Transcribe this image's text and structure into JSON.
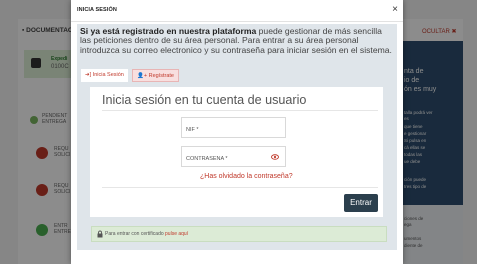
{
  "background": {
    "doc_title": "DOCUMENTACI",
    "hide_label": "OCULTAR",
    "hide_icon": "close-icon",
    "left_items": [
      {
        "line1": "Expedi",
        "line2": "0100C"
      },
      {
        "line1": "PENDIENT",
        "line2": "ENTREGA"
      },
      {
        "line1": "REQU",
        "line2": "SOLICI"
      },
      {
        "line1": "REQU",
        "line2": "SOLICI"
      },
      {
        "line1": "ENTR",
        "line2": "ENTRE"
      }
    ],
    "right_heading": [
      "nta de",
      "io de",
      "ón es muy"
    ],
    "right_text": [
      "talla podrá ver",
      "es",
      "que tiene",
      "e gestionar",
      "Si pulsa en",
      "cá ellas se",
      "todas las",
      "ue debe"
    ],
    "right_text2": [
      "ción puede",
      "tres tipo de"
    ],
    "right_lower": [
      "ciones de",
      "ega",
      "umentos",
      "diente de"
    ]
  },
  "modal": {
    "title": "INICIA SESIÓN",
    "close_icon": "×",
    "intro_bold": "Si ya está registrado en nuestra plataforma",
    "intro_rest": " puede gestionar de más sencilla las peticiones dentro de su área personal. Para entrar a su área personal introduzca su correo electronico y su contraseña para iniciar sesión en el sistema.",
    "tabs": [
      {
        "icon": "➜]",
        "label": "Inicia Sesión"
      },
      {
        "icon": "👤+",
        "label": "Regístrate"
      }
    ],
    "form": {
      "title": "Inicia sesión en tu cuenta de usuario",
      "nif_placeholder": "NIF *",
      "password_placeholder": "CONTRASEÑA *",
      "forgot_label": "¿Has olvidado la contraseña?",
      "enter_label": "Entrar"
    },
    "certificate": {
      "text": "Para entrar con certificado ",
      "link": "pulse aquí"
    }
  },
  "colors": {
    "accent": "#c0392b",
    "button": "#2b3f4d",
    "panel": "#dfe5ea",
    "cert_bg": "#dcebd6"
  }
}
